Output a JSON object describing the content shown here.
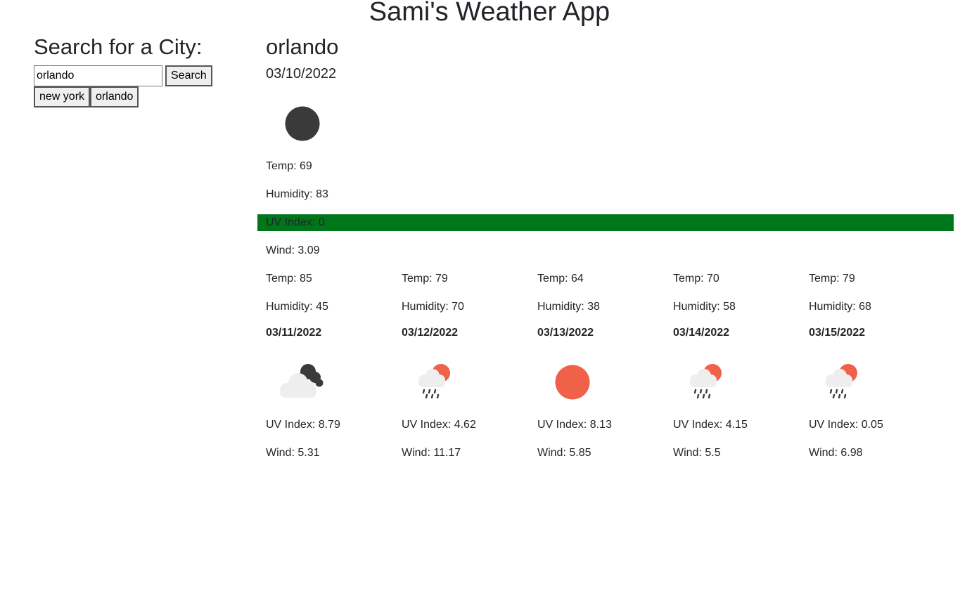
{
  "app": {
    "title": "Sami's Weather App"
  },
  "search": {
    "heading": "Search for a City:",
    "input_value": "orlando",
    "button_label": "Search",
    "history": [
      "new york",
      "orlando"
    ]
  },
  "current": {
    "city": "orlando",
    "date": "03/10/2022",
    "icon": "moon-icon",
    "temp": "Temp: 69",
    "humidity": "Humidity: 83",
    "uv": "UV Index: 0",
    "uv_color": "#00761a",
    "wind": "Wind: 3.09"
  },
  "forecast": [
    {
      "temp": "Temp: 85",
      "humidity": "Humidity: 45",
      "date": "03/11/2022",
      "icon": "night-cloudy-icon",
      "uv": "UV Index: 8.79",
      "wind": "Wind: 5.31"
    },
    {
      "temp": "Temp: 79",
      "humidity": "Humidity: 70",
      "date": "03/12/2022",
      "icon": "sun-rain-icon",
      "uv": "UV Index: 4.62",
      "wind": "Wind: 11.17"
    },
    {
      "temp": "Temp: 64",
      "humidity": "Humidity: 38",
      "date": "03/13/2022",
      "icon": "sun-icon",
      "uv": "UV Index: 8.13",
      "wind": "Wind: 5.85"
    },
    {
      "temp": "Temp: 70",
      "humidity": "Humidity: 58",
      "date": "03/14/2022",
      "icon": "sun-rain-icon",
      "uv": "UV Index: 4.15",
      "wind": "Wind: 5.5"
    },
    {
      "temp": "Temp: 79",
      "humidity": "Humidity: 68",
      "date": "03/15/2022",
      "icon": "sun-rain-icon",
      "uv": "UV Index: 0.05",
      "wind": "Wind: 6.98"
    }
  ],
  "colors": {
    "sun": "#ef6148",
    "moon": "#3a3a3a",
    "cloud": "#eeeeee"
  }
}
